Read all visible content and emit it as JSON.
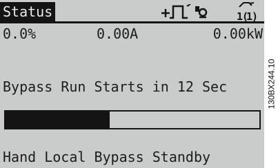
{
  "display": {
    "header": {
      "title": "Status",
      "icons": [
        "hand-arrow-step-icon",
        "bypass-relay-icon",
        "grid-power-icon"
      ]
    },
    "readouts": {
      "percent": "0.0%",
      "current": "0.00A",
      "power": "0.00kW"
    },
    "message": "Bypass Run Starts in 12 Sec",
    "progress": {
      "fraction": 0.41
    },
    "state_line": "Hand Local Bypass Standby"
  },
  "side_label": "130BX244.10",
  "colors": {
    "lcd_background": "#c9ccca",
    "lcd_ink": "#141414",
    "inverse_text": "#e9ebe9"
  }
}
